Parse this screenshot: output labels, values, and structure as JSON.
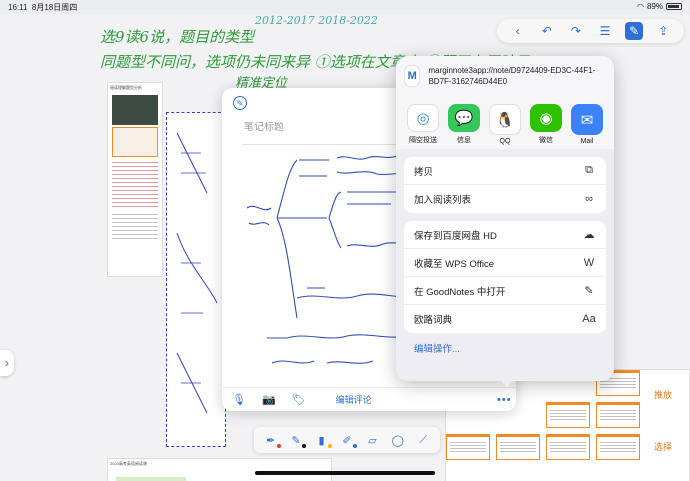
{
  "status_bar": {
    "time": "16:11",
    "date": "8月18日周四",
    "battery": "89%"
  },
  "canvas": {
    "handwriting": [
      "选9读6说，题目的类型",
      "同题型不同问，选项仍未同来异 ①选项在文章中 ②题干有无暗示",
      "精准定位",
      "2012-2017 2018-2022"
    ],
    "page_title": "阅读理解题型分析",
    "bottom_page_title": "2023高考英语阅读课",
    "tags": [
      "推放",
      "选择"
    ]
  },
  "toolbar": {
    "items": [
      {
        "name": "back-icon",
        "glyph": "‹"
      },
      {
        "name": "undo-icon",
        "glyph": "↶"
      },
      {
        "name": "redo-icon",
        "glyph": "↷"
      },
      {
        "name": "list-icon",
        "glyph": "☰"
      },
      {
        "name": "pen-mode-icon",
        "glyph": "✎"
      },
      {
        "name": "share-icon",
        "glyph": "⇪"
      }
    ]
  },
  "note": {
    "title_placeholder": "笔记标题",
    "edit_comment": "编辑评论",
    "bottom_icons": [
      "mic-icon",
      "camera-icon",
      "tag-icon"
    ]
  },
  "pen_tray": {
    "tools": [
      {
        "name": "fountain-pen-icon",
        "dot": "#e53935"
      },
      {
        "name": "ballpoint-pen-icon",
        "dot": "#111111"
      },
      {
        "name": "highlighter-icon",
        "dot": "#f4b400"
      },
      {
        "name": "marker-icon",
        "dot": "#2f6fd6"
      },
      {
        "name": "eraser-icon",
        "dot": ""
      },
      {
        "name": "lasso-icon",
        "dot": ""
      },
      {
        "name": "ruler-icon",
        "dot": ""
      }
    ]
  },
  "share_sheet": {
    "url": "marginnote3app://note/D9724409-ED3C-44F1-BD7F-3162746D44E0",
    "apps": [
      {
        "label": "隔空投送",
        "icon": "airdrop-icon",
        "glyph": "◎"
      },
      {
        "label": "信息",
        "icon": "messages-icon",
        "glyph": "💬"
      },
      {
        "label": "QQ",
        "icon": "qq-icon",
        "glyph": "🐧"
      },
      {
        "label": "微信",
        "icon": "wechat-icon",
        "glyph": "◉"
      },
      {
        "label": "Mail",
        "icon": "mail-icon",
        "glyph": "✉"
      }
    ],
    "group1": [
      {
        "label": "拷贝",
        "icon": "copy-icon",
        "glyph": "⧉"
      },
      {
        "label": "加入阅读列表",
        "icon": "glasses-icon",
        "glyph": "∞"
      }
    ],
    "group2": [
      {
        "label": "保存到百度网盘 HD",
        "icon": "baidu-cloud-icon",
        "glyph": "☁"
      },
      {
        "label": "收藏至 WPS Office",
        "icon": "wps-icon",
        "glyph": "W"
      },
      {
        "label": "在 GoodNotes 中打开",
        "icon": "goodnotes-icon",
        "glyph": "✎"
      },
      {
        "label": "欧路词典",
        "icon": "eudic-icon",
        "glyph": "Aa"
      }
    ],
    "edit_actions": "编辑操作..."
  }
}
